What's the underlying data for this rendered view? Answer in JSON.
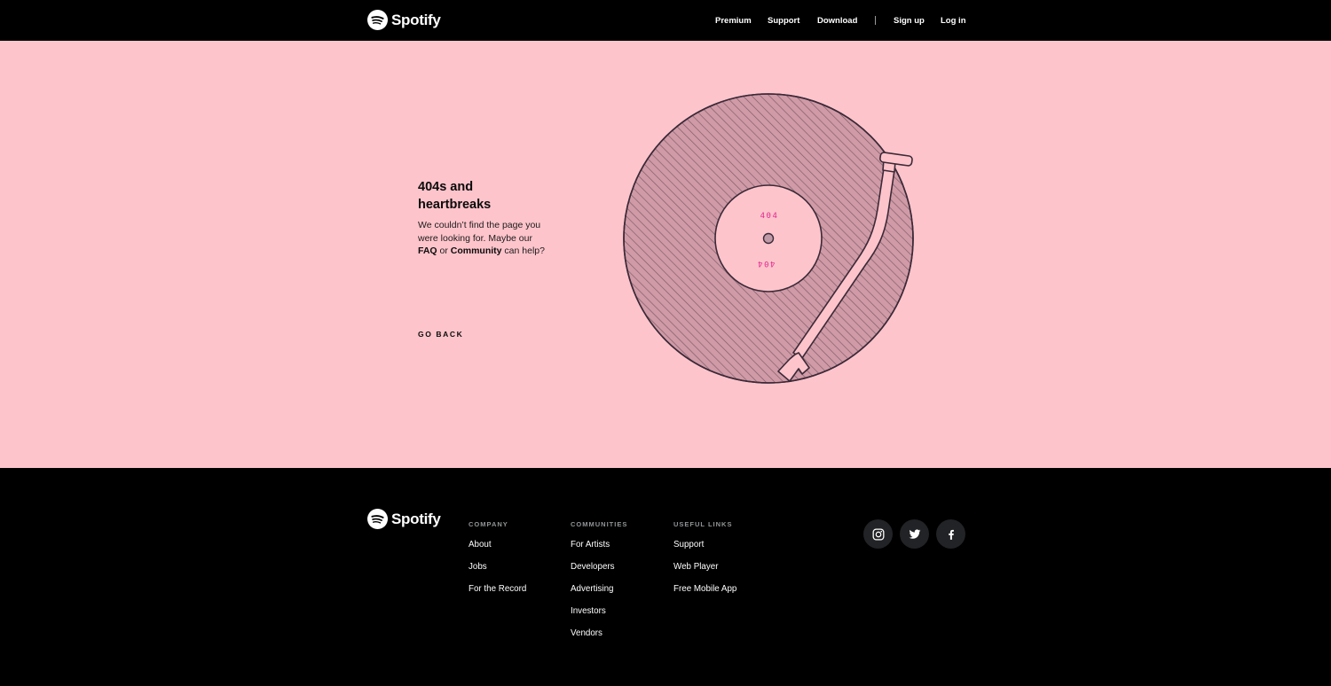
{
  "header": {
    "brand": "Spotify",
    "nav": {
      "premium": "Premium",
      "support": "Support",
      "download": "Download",
      "signup": "Sign up",
      "login": "Log in"
    }
  },
  "hero": {
    "title": "404s and heartbreaks",
    "body_pre": "We couldn’t find the page you were looking for. Maybe our ",
    "faq": "FAQ",
    "body_mid": " or ",
    "community": "Community",
    "body_post": " can help?",
    "go_back": "GO BACK",
    "record_label_top": "404",
    "record_label_bottom": "404",
    "colors": {
      "background": "#fec4cb",
      "record_fill": "#d09aa6",
      "outline": "#3b2a38",
      "label_text": "#e2288f"
    }
  },
  "footer": {
    "brand": "Spotify",
    "columns": [
      {
        "title": "COMPANY",
        "links": [
          "About",
          "Jobs",
          "For the Record"
        ]
      },
      {
        "title": "COMMUNITIES",
        "links": [
          "For Artists",
          "Developers",
          "Advertising",
          "Investors",
          "Vendors"
        ]
      },
      {
        "title": "USEFUL LINKS",
        "links": [
          "Support",
          "Web Player",
          "Free Mobile App"
        ]
      }
    ],
    "social": [
      "instagram-icon",
      "twitter-icon",
      "facebook-icon"
    ]
  }
}
